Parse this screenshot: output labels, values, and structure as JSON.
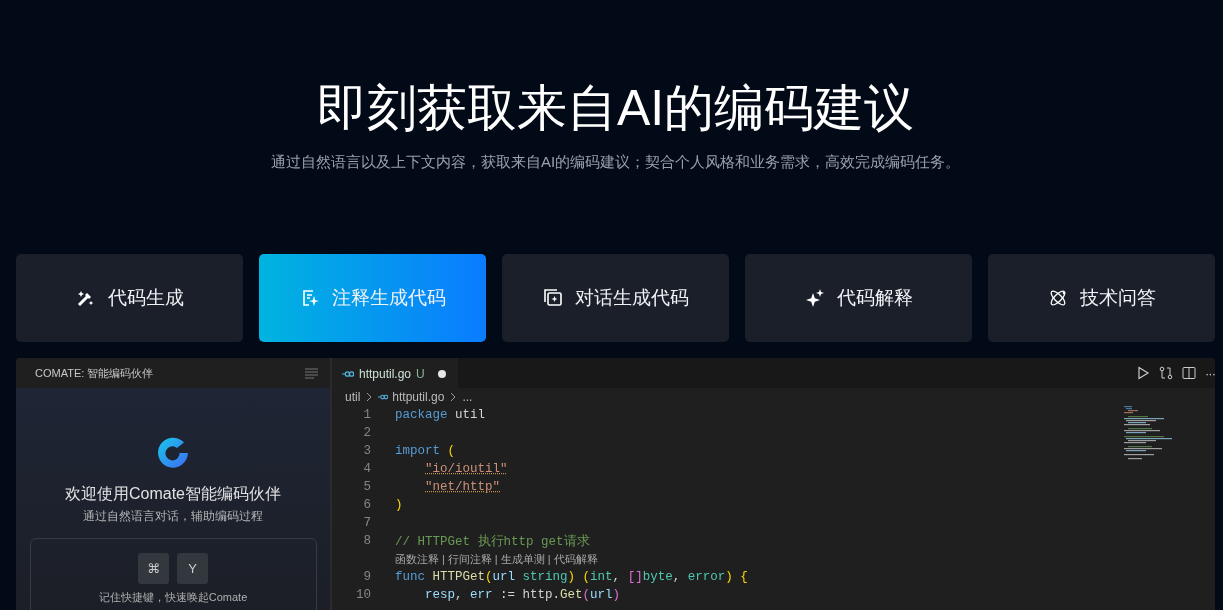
{
  "hero": {
    "title": "即刻获取来自AI的编码建议",
    "subtitle": "通过自然语言以及上下文内容，获取来自AI的编码建议；契合个人风格和业务需求，高效完成编码任务。"
  },
  "feature_tabs": [
    {
      "label": "代码生成",
      "selected": false
    },
    {
      "label": "注释生成代码",
      "selected": true
    },
    {
      "label": "对话生成代码",
      "selected": false
    },
    {
      "label": "代码解释",
      "selected": false
    },
    {
      "label": "技术问答",
      "selected": false
    }
  ],
  "demo": {
    "sidebar": {
      "title": "COMATE: 智能编码伙伴",
      "welcome": "欢迎使用Comate智能编码伙伴",
      "subtitle": "通过自然语言对话，辅助编码过程",
      "keys": [
        "⌘",
        "Y"
      ],
      "hint": "记住快捷键，快速唤起Comate"
    },
    "editor": {
      "tab": {
        "filename": "httputil.go",
        "status": "U",
        "modified": true
      },
      "more_actions": "···",
      "breadcrumb": [
        "util",
        "httputil.go",
        "..."
      ],
      "lines": [
        {
          "kind": "code",
          "number": "1",
          "tokens": [
            {
              "kind": "keyword",
              "text": "package "
            },
            {
              "kind": "plain",
              "text": "util"
            }
          ]
        },
        {
          "kind": "code",
          "number": "2"
        },
        {
          "kind": "code",
          "number": "3",
          "tokens": [
            {
              "kind": "keyword",
              "text": "import "
            },
            {
              "kind": "paren",
              "text": "("
            }
          ]
        },
        {
          "kind": "code",
          "number": "4",
          "indented": true,
          "tokens": [
            {
              "kind": "string",
              "text": "\"io/ioutil\""
            }
          ]
        },
        {
          "kind": "code",
          "number": "5",
          "indented": true,
          "tokens": [
            {
              "kind": "string",
              "text": "\"net/http\""
            }
          ]
        },
        {
          "kind": "code",
          "number": "6",
          "tokens": [
            {
              "kind": "paren",
              "text": ")"
            }
          ]
        },
        {
          "kind": "code",
          "number": "7"
        },
        {
          "kind": "code",
          "number": "8",
          "tokens": [
            {
              "kind": "comment",
              "text": "// HTTPGet 执行http get请求"
            }
          ]
        },
        {
          "kind": "codelens",
          "separator": "|",
          "actions": [
            "函数注释",
            "行间注释",
            "生成单测",
            "代码解释"
          ]
        },
        {
          "kind": "code",
          "number": "9",
          "tokens": [
            {
              "kind": "keyword",
              "text": "func "
            },
            {
              "kind": "function",
              "text": "HTTPGet"
            },
            {
              "kind": "paren",
              "text": "("
            },
            {
              "kind": "variable",
              "text": "url "
            },
            {
              "kind": "type",
              "text": "string"
            },
            {
              "kind": "paren",
              "text": ") ("
            },
            {
              "kind": "type",
              "text": "int"
            },
            {
              "kind": "plain",
              "text": ", "
            },
            {
              "kind": "bracket",
              "text": "[]"
            },
            {
              "kind": "type",
              "text": "byte"
            },
            {
              "kind": "plain",
              "text": ", "
            },
            {
              "kind": "type",
              "text": "error"
            },
            {
              "kind": "paren",
              "text": ") {"
            }
          ]
        },
        {
          "kind": "code",
          "number": "10",
          "indented": true,
          "tokens": [
            {
              "kind": "variable",
              "text": "resp"
            },
            {
              "kind": "plain",
              "text": ", "
            },
            {
              "kind": "variable",
              "text": "err"
            },
            {
              "kind": "plain",
              "text": " := http."
            },
            {
              "kind": "function",
              "text": "Get"
            },
            {
              "kind": "bracket",
              "text": "("
            },
            {
              "kind": "variable",
              "text": "url"
            },
            {
              "kind": "bracket",
              "text": ")"
            }
          ]
        }
      ]
    }
  }
}
